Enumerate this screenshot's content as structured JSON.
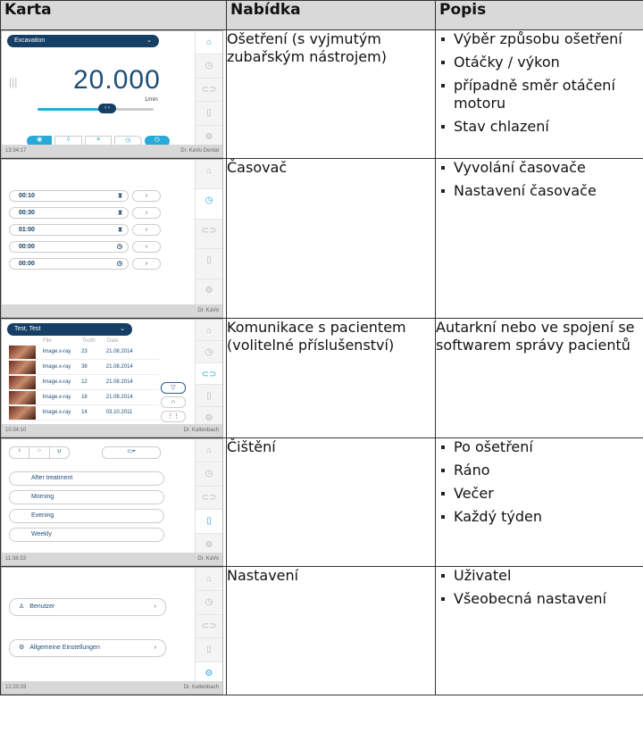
{
  "headers": {
    "card": "Karta",
    "menu": "Nabídka",
    "desc": "Popis"
  },
  "rows": [
    {
      "menu": "Ošetření (s vyjmutým zubařským nástrojem)",
      "desc": [
        "Výběr způsobu ošetření",
        "Otáčky / výkon",
        "případně směr otáčení motoru",
        "Stav chlazení"
      ],
      "shot": {
        "dropdown": "Excavation",
        "speed": "20.000",
        "unit": "1/min",
        "time": "13:34:17",
        "user": "Dr. KaVo Dental"
      }
    },
    {
      "menu": "Časovač",
      "desc": [
        "Vyvolání časovače",
        "Nastavení časovače"
      ],
      "shot": {
        "timers": [
          "00:10",
          "00:30",
          "01:00",
          "00:00",
          "00:00"
        ],
        "user": "Dr. KaVo"
      }
    },
    {
      "menu": "Komunikace s pacientem (volitelné příslušenství)",
      "desc_text": "Autarkní nebo ve spojení se softwarem správy pacientů",
      "shot": {
        "dropdown": "Test, Test",
        "col_headers": [
          "File",
          "Tooth",
          "Date"
        ],
        "images": [
          {
            "file": "Image.x-ray",
            "tooth": "23",
            "date": "21.08.2014"
          },
          {
            "file": "Image.x-ray",
            "tooth": "38",
            "date": "21.08.2014"
          },
          {
            "file": "Image.x-ray",
            "tooth": "12",
            "date": "21.08.2014"
          },
          {
            "file": "Image.x-ray",
            "tooth": "18",
            "date": "21.08.2014"
          },
          {
            "file": "Image.x-ray",
            "tooth": "14",
            "date": "03.10.2011"
          }
        ],
        "time": "10:34:10",
        "user": "Dr. Kaltenbach"
      }
    },
    {
      "menu": "Čištění",
      "desc": [
        "Po ošetření",
        "Ráno",
        "Večer",
        "Každý týden"
      ],
      "shot": {
        "programs": [
          "After treatment",
          "Morning",
          "Evening",
          "Weekly"
        ],
        "time": "11:38:33",
        "user": "Dr. KaVo"
      }
    },
    {
      "menu": "Nastavení",
      "desc": [
        "Uživatel",
        "Všeobecná nastavení"
      ],
      "shot": {
        "items": [
          "Benutzer",
          "Allgemeine Einstellungen"
        ],
        "time": "12:20:33",
        "user": "Dr. Kaltenbach"
      }
    }
  ],
  "colors": {
    "accent": "#2aa8d8",
    "navy": "#153f64",
    "header_bg": "#d9d9d9"
  }
}
